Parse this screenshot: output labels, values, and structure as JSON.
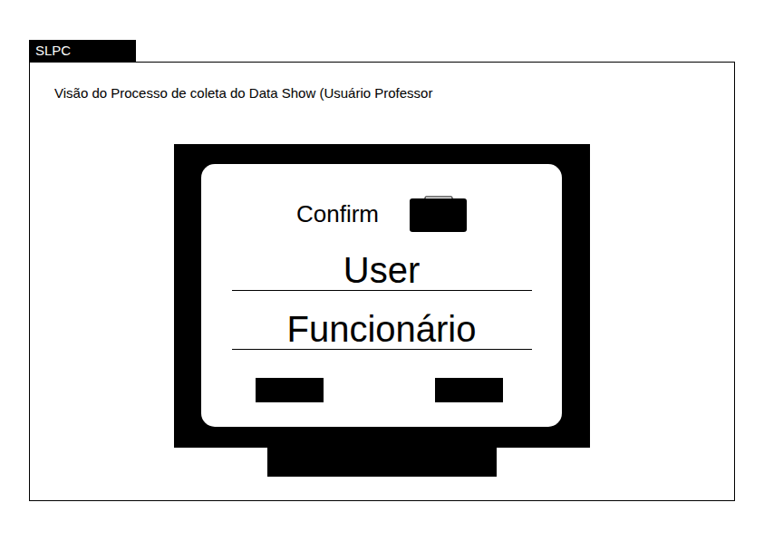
{
  "tab": {
    "label": "SLPC"
  },
  "title": "Visão do Processo de coleta do Data Show (Usuário Professor",
  "screen": {
    "confirm": {
      "label": "Confirm"
    },
    "fields": [
      {
        "value": "User"
      },
      {
        "value": "Funcionário"
      }
    ]
  }
}
